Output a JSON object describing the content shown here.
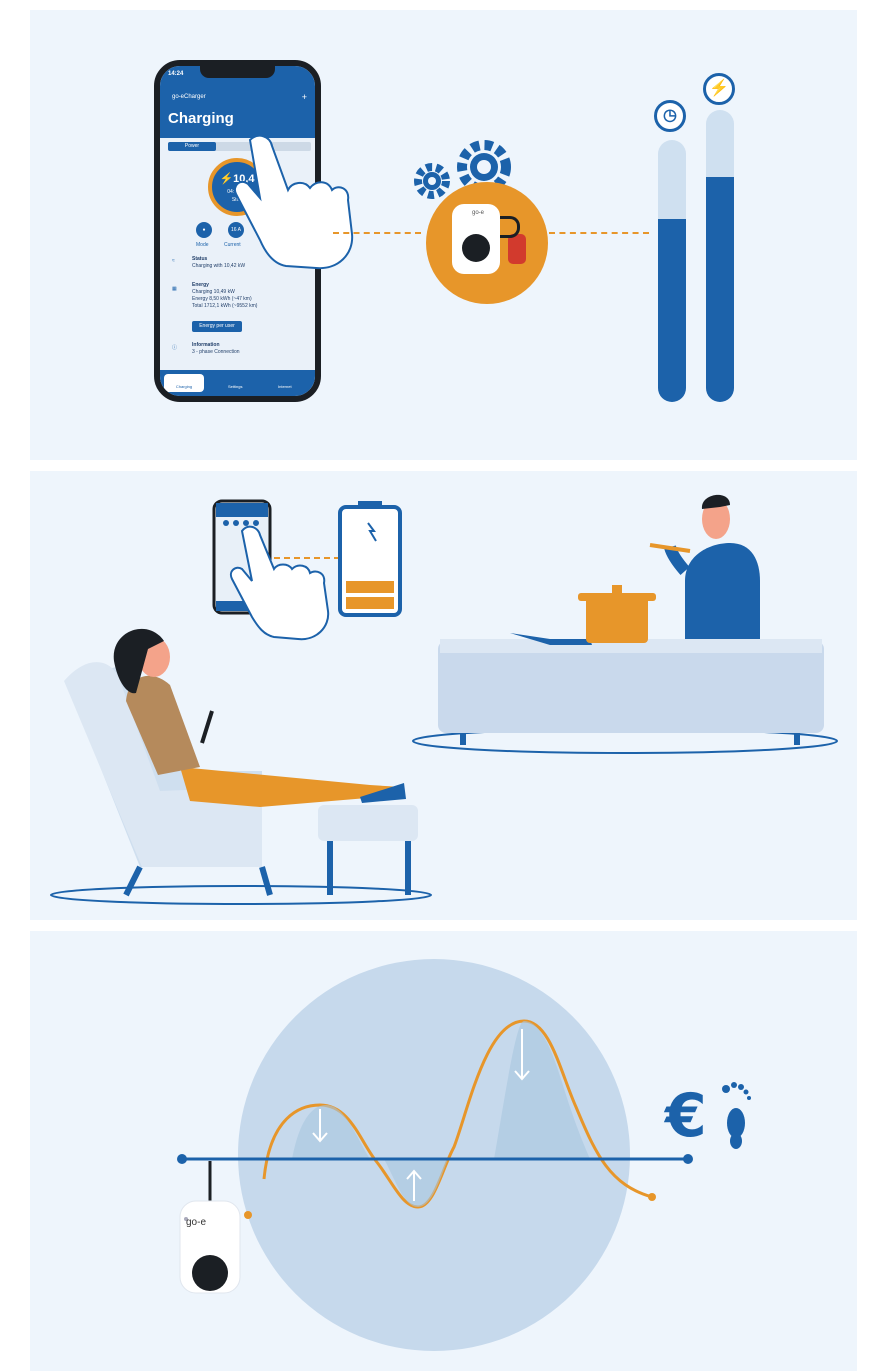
{
  "phone": {
    "time": "14:24",
    "app_name": "go-eCharger",
    "plus": "+",
    "title": "Charging",
    "tabs": [
      "Power"
    ],
    "gauge_value": "⚡10,4",
    "gauge_time": "04:14:50",
    "gauge_action": "Stop",
    "mode_label": "Mode",
    "current_value": "16 A",
    "current_label": "Current",
    "status_title": "Status",
    "status_text": "Charging with 10,42 kW",
    "energy_title": "Energy",
    "energy_lines": [
      "Charging 10,49 kW",
      "Energy 8,50 kWh (~47 km)",
      "Total 1712,1 kWh (~9552 km)"
    ],
    "energy_button": "Energy per user",
    "info_title": "Information",
    "info_line": "3 - phase Connection",
    "nav": [
      "Charging",
      "Settings",
      "Internet"
    ]
  },
  "charger_brand": "go-e",
  "bars": {
    "time_level": 0.7,
    "energy_level": 0.77
  },
  "icons": {
    "clock": "clock-icon",
    "bolt": "lightning-icon",
    "euro": "euro-icon",
    "footprint": "footprint-icon"
  },
  "currency_symbol": "€",
  "colors": {
    "blue": "#1c62aa",
    "orange": "#e7962a",
    "panel": "#eef5fc"
  }
}
